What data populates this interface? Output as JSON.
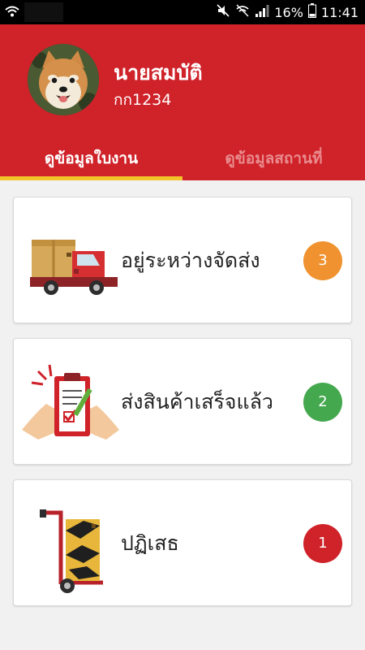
{
  "status_bar": {
    "battery_percent": "16%",
    "time": "11:41",
    "icons": [
      "wifi-icon",
      "mute-icon",
      "wifi-calling-icon",
      "signal-icon",
      "battery-icon"
    ]
  },
  "profile": {
    "name": "นายสมบัติ",
    "id": "กก1234",
    "avatar": "shiba-dog-avatar"
  },
  "tabs": [
    {
      "label": "ดูข้อมูลใบงาน",
      "active": true
    },
    {
      "label": "ดูข้อมูลสถานที่",
      "active": false
    }
  ],
  "cards": [
    {
      "label": "อยู่ระหว่างจัดส่ง",
      "count": "3",
      "badge_color": "#f0922f",
      "icon": "delivery-truck-icon"
    },
    {
      "label": "ส่งสินค้าเสร็จแล้ว",
      "count": "2",
      "badge_color": "#44a84f",
      "icon": "clipboard-check-icon"
    },
    {
      "label": "ปฏิเสธ",
      "count": "1",
      "badge_color": "#cf2229",
      "icon": "hand-trolley-icon"
    }
  ],
  "colors": {
    "header": "#cf2229",
    "tab_indicator": "#f3c32b",
    "background": "#f1f1f1"
  }
}
